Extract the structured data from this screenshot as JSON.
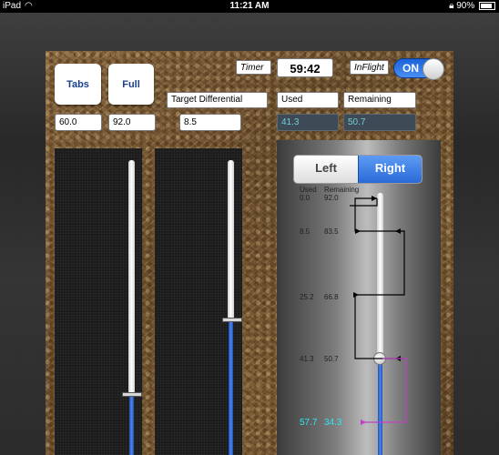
{
  "status_bar": {
    "device": "iPad",
    "time": "11:21 AM",
    "battery": "90%"
  },
  "buttons": {
    "tabs": "Tabs",
    "full": "Full"
  },
  "fields": {
    "tabs_value": "60.0",
    "full_value": "92.0",
    "target_differential_label": "Target Differential",
    "target_differential_value": "8.5"
  },
  "timer": {
    "label": "Timer",
    "value": "59:42"
  },
  "inflight": {
    "label": "InFlight",
    "toggle": "ON"
  },
  "used": {
    "label": "Used",
    "value": "41.3"
  },
  "remaining": {
    "label": "Remaining",
    "value": "50.7"
  },
  "segmented": {
    "left": "Left",
    "right": "Right",
    "selected": "Right"
  },
  "chart_headers": {
    "used": "Used",
    "remaining": "Remaining"
  },
  "chart_rows": [
    {
      "used": "0.0",
      "remaining": "92.0"
    },
    {
      "used": "8.5",
      "remaining": "83.5"
    },
    {
      "used": "25.2",
      "remaining": "66.8"
    },
    {
      "used": "41.3",
      "remaining": "50.7"
    },
    {
      "used": "57.7",
      "remaining": "34.3"
    }
  ],
  "sliders": {
    "left_level": 0.25,
    "middle_level": 0.5,
    "tank_level": 0.34
  },
  "colors": {
    "accent": "#2f6fe0",
    "cyan": "#2ee6f2",
    "magenta": "#cc44cc"
  }
}
